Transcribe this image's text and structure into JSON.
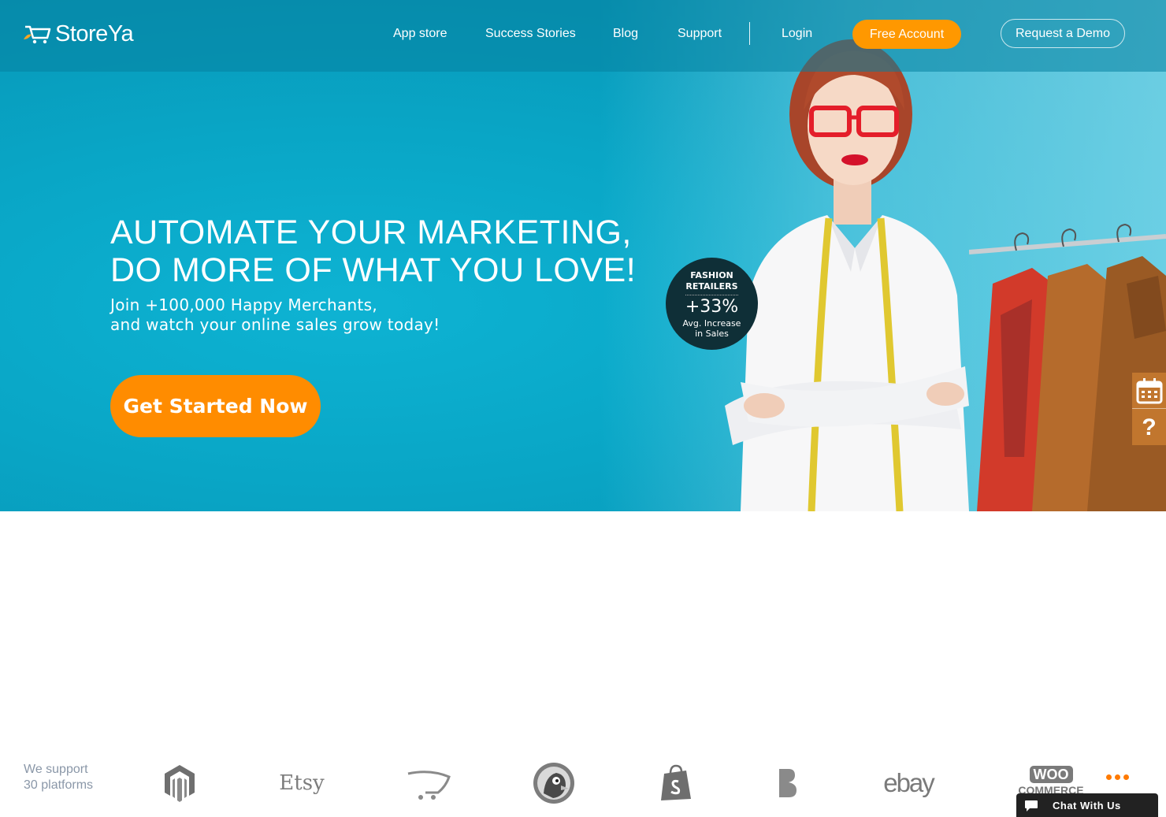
{
  "brand": {
    "name": "StoreYa"
  },
  "nav": {
    "links": [
      "App store",
      "Success Stories",
      "Blog",
      "Support"
    ],
    "login": "Login",
    "free_account": "Free Account",
    "request_demo": "Request a Demo"
  },
  "hero": {
    "headline_line1": "AUTOMATE YOUR MARKETING,",
    "headline_line2": "DO MORE OF WHAT YOU LOVE!",
    "sub_line1": "Join +100,000 Happy Merchants,",
    "sub_line2": "and watch your online sales grow today!",
    "cta": "Get Started Now"
  },
  "badge": {
    "line1": "FASHION",
    "line2": "RETAILERS",
    "value": "+33%",
    "line3": "Avg. Increase",
    "line4": "in Sales"
  },
  "side_widget": {
    "items": [
      "calendar-icon",
      "help-icon"
    ],
    "help_glyph": "?"
  },
  "platforms": {
    "support_line1": "We support",
    "support_line2": "30 platforms",
    "logos": [
      "magento-logo",
      "etsy-logo",
      "opencart-logo",
      "prestashop-logo",
      "shopify-logo",
      "bigcommerce-logo",
      "ebay-logo",
      "woocommerce-logo"
    ],
    "etsy_text": "Etsy",
    "ebay_text": "ebay",
    "woo_line1": "WOO",
    "woo_line2": "COMMERCE"
  },
  "chat": {
    "label": "Chat With Us"
  },
  "colors": {
    "accent_orange": "#ff9800",
    "hero_teal": "#09a6c6",
    "badge_dark": "#0f2f37",
    "chat_dark": "#222222"
  }
}
